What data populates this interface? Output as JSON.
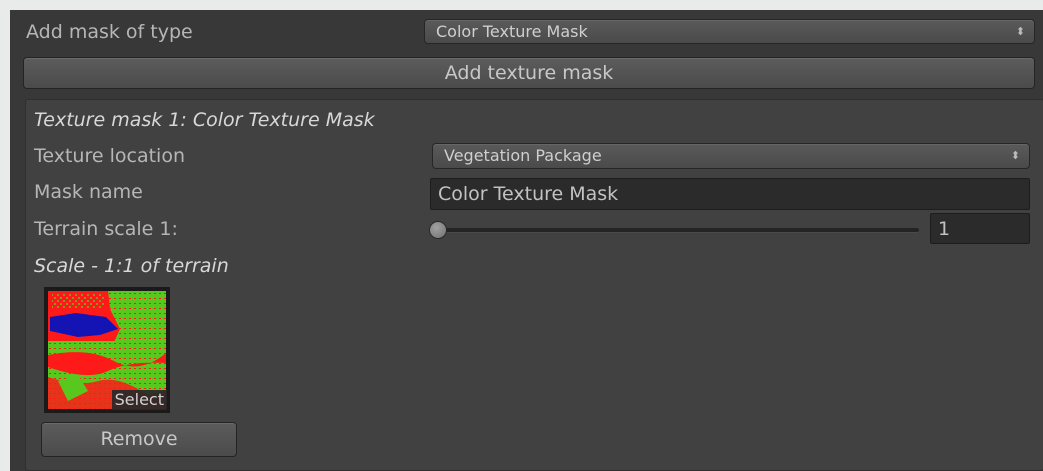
{
  "header": {
    "type_label": "Add mask of type",
    "type_value": "Color Texture Mask",
    "add_button": "Add texture mask"
  },
  "mask": {
    "title": "Texture mask 1: Color Texture Mask",
    "location_label": "Texture location",
    "location_value": "Vegetation Package",
    "name_label": "Mask name",
    "name_value": "Color Texture Mask",
    "scale_label": "Terrain scale 1:",
    "scale_value": "1",
    "scale_fraction": 0.0,
    "scale_caption": "Scale - 1:1 of terrain",
    "select_label": "Select",
    "remove_button": "Remove"
  },
  "icons": {
    "dropdown": "updown-arrows-icon"
  },
  "colors": {
    "panel_bg": "#383838",
    "box_bg": "#414141",
    "texture_red": "#ff1a1a",
    "texture_green": "#59c81e",
    "texture_blue": "#1414b4"
  }
}
